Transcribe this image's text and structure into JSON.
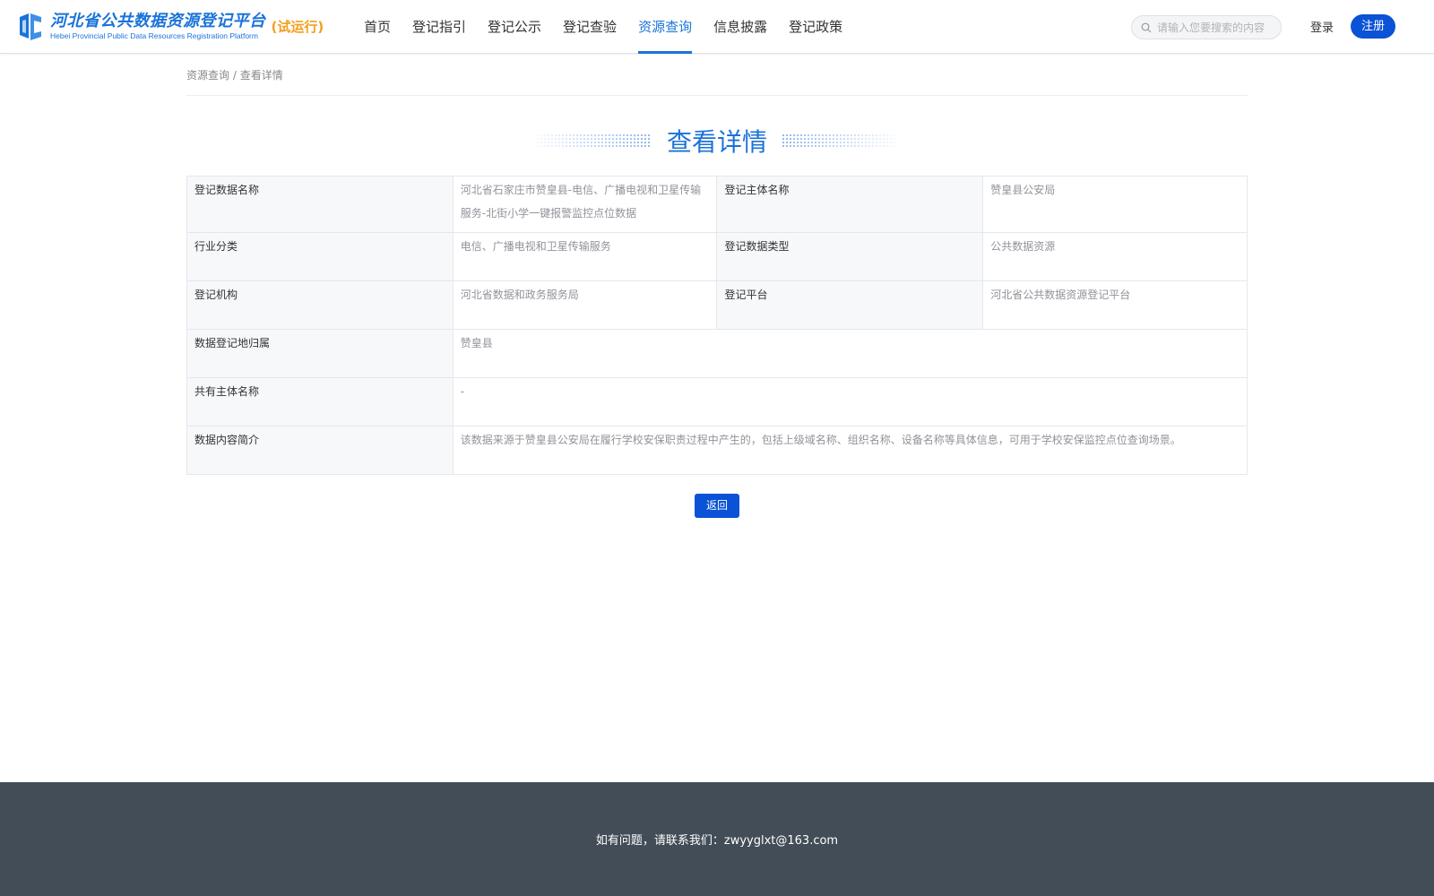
{
  "header": {
    "logo_cn": "河北省公共数据资源登记平台",
    "logo_en": "Hebei Provincial Public Data Resources Registration Platform",
    "trial_label": "(试运行)",
    "nav": [
      {
        "label": "首页",
        "active": false
      },
      {
        "label": "登记指引",
        "active": false
      },
      {
        "label": "登记公示",
        "active": false
      },
      {
        "label": "登记查验",
        "active": false
      },
      {
        "label": "资源查询",
        "active": true
      },
      {
        "label": "信息披露",
        "active": false
      },
      {
        "label": "登记政策",
        "active": false
      }
    ],
    "search_placeholder": "请输入您要搜索的内容",
    "login_label": "登录",
    "register_label": "注册"
  },
  "breadcrumb": {
    "parent": "资源查询",
    "separator": " / ",
    "current": "查看详情"
  },
  "page_title": "查看详情",
  "detail": {
    "row1": {
      "label_a": "登记数据名称",
      "value_a": "河北省石家庄市赞皇县-电信、广播电视和卫星传输服务-北街小学一键报警监控点位数据",
      "label_b": "登记主体名称",
      "value_b": "赞皇县公安局"
    },
    "row2": {
      "label_a": "行业分类",
      "value_a": "电信、广播电视和卫星传输服务",
      "label_b": "登记数据类型",
      "value_b": "公共数据资源"
    },
    "row3": {
      "label_a": "登记机构",
      "value_a": "河北省数据和政务服务局",
      "label_b": "登记平台",
      "value_b": "河北省公共数据资源登记平台"
    },
    "row4": {
      "label": "数据登记地归属",
      "value": "赞皇县"
    },
    "row5": {
      "label": "共有主体名称",
      "value": "-"
    },
    "row6": {
      "label": "数据内容简介",
      "value": "该数据来源于赞皇县公安局在履行学校安保职责过程中产生的，包括上级域名称、组织名称、设备名称等具体信息，可用于学校安保监控点位查询场景。"
    }
  },
  "back_label": "返回",
  "footer_text": "如有问题，请联系我们：zwyyglxt@163.com",
  "colors": {
    "primary": "#1a73d9",
    "button": "#0a52d6",
    "trial": "#f0a020",
    "footer_bg": "#434d57"
  }
}
